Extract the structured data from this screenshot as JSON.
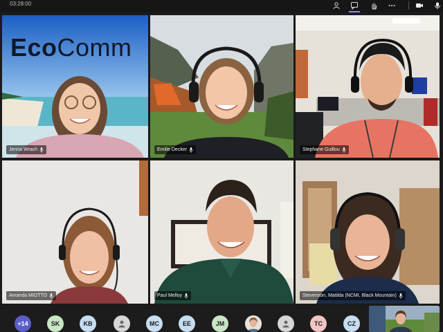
{
  "call": {
    "timer": "03:28:00"
  },
  "participants": [
    {
      "name": "Jenna Wrach"
    },
    {
      "name": "Emilie Decker"
    },
    {
      "name": "Stephane Guillou"
    },
    {
      "name": "Amanda MIOTTO"
    },
    {
      "name": "Paul Melloy"
    },
    {
      "name": "Stevenson, Matilda (NCMI, Black Mountain)"
    }
  ],
  "background_banner": {
    "bold": "Eco",
    "light": "Comm"
  },
  "roster": {
    "overflow": "+14",
    "avatars": [
      {
        "initials": "SK",
        "color": "#c8e6c4"
      },
      {
        "initials": "KB",
        "color": "#c6ddf2"
      },
      {
        "initials": "",
        "color": "#d6d6d6",
        "kind": "person-icon"
      },
      {
        "initials": "MC",
        "color": "#c6ddf2"
      },
      {
        "initials": "EE",
        "color": "#c6ddf2"
      },
      {
        "initials": "JM",
        "color": "#c8e6c4"
      },
      {
        "initials": "",
        "color": "#d8c2a8",
        "kind": "photo"
      },
      {
        "initials": "",
        "color": "#d6d6d6",
        "kind": "person-icon"
      },
      {
        "initials": "TC",
        "color": "#f2c4c4"
      },
      {
        "initials": "CZ",
        "color": "#c6ddf2"
      }
    ],
    "overflow_color": "#5b5fc7"
  },
  "icons": {
    "toolbar": [
      "people-icon",
      "chat-icon",
      "raise-hand-icon",
      "more-icon",
      "camera-icon",
      "mic-icon"
    ]
  }
}
